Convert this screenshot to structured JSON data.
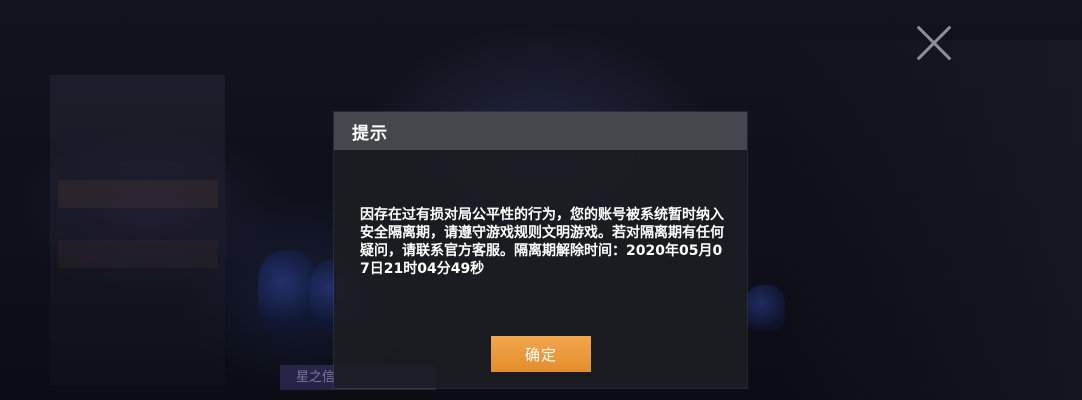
{
  "background": {
    "banner_text": "星之信"
  },
  "dialog": {
    "title": "提示",
    "message": "因存在过有损对局公平性的行为，您的账号被系统暂时纳入安全隔离期，请遵守游戏规则文明游戏。若对隔离期有任何疑问，请联系官方客服。隔离期解除时间：2020年05月07日21时04分49秒",
    "confirm_label": "确定"
  },
  "icons": {
    "close": "close-icon"
  },
  "colors": {
    "header_bg": "#45474c",
    "dialog_bg": "#1c1d22",
    "confirm_button": "#f0a041",
    "text": "#ffffff"
  }
}
